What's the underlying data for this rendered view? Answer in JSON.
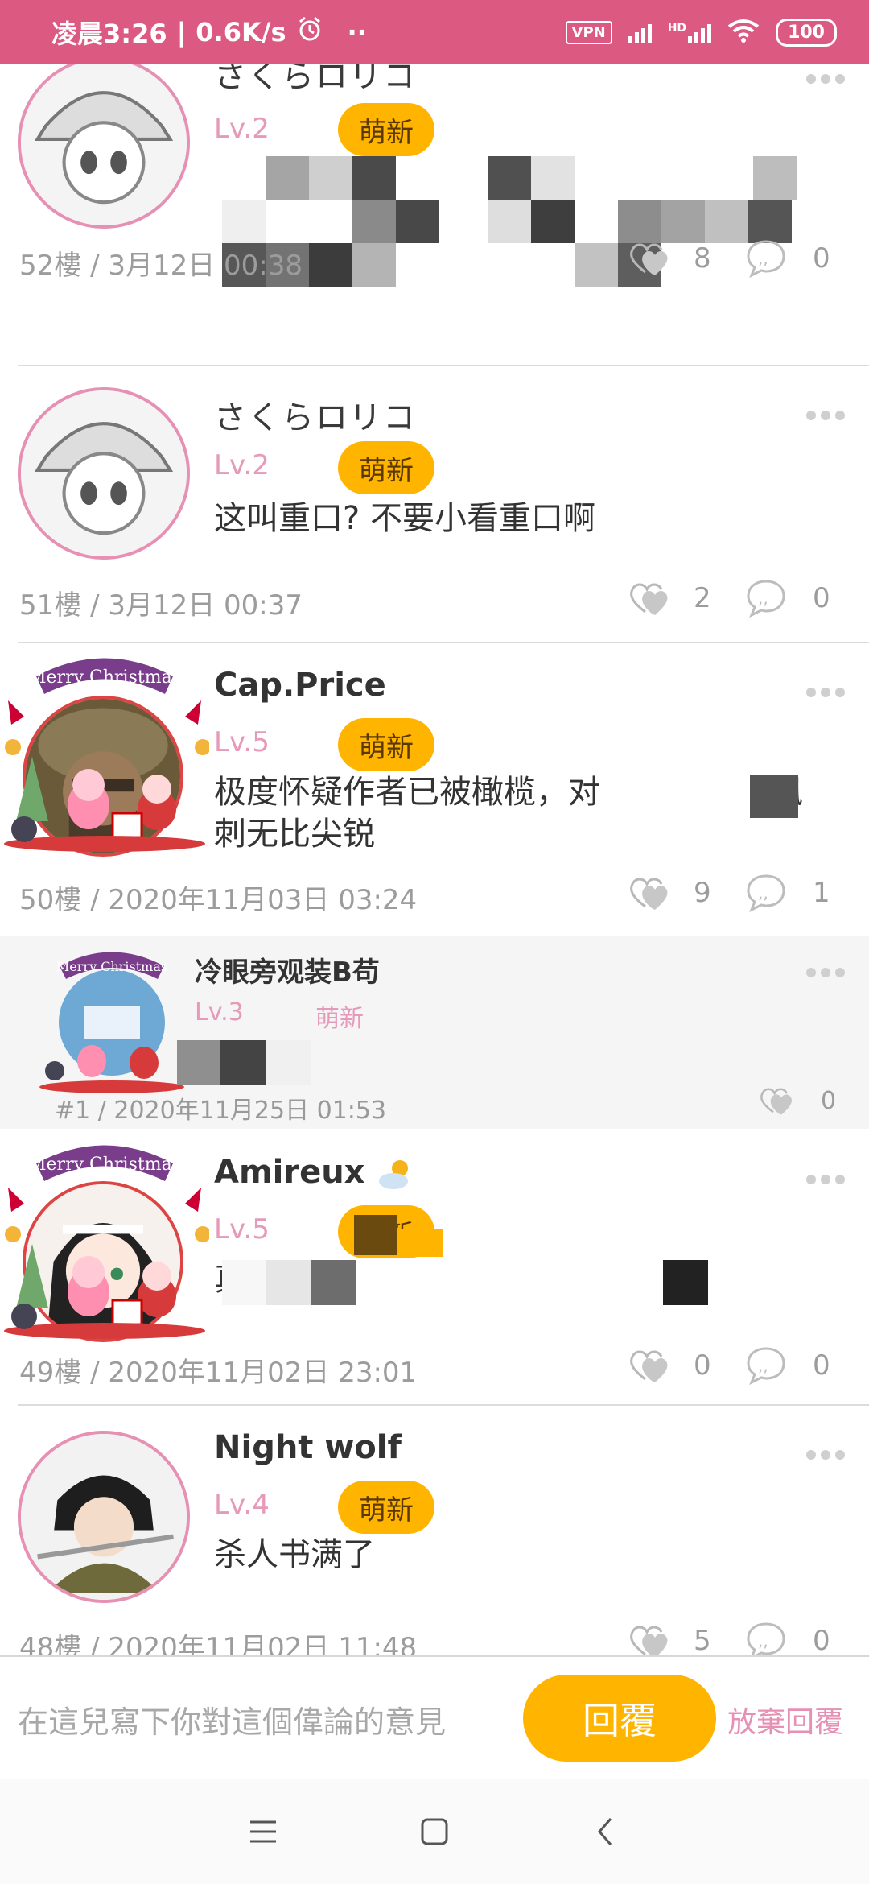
{
  "status_bar": {
    "time": "凌晨3:26",
    "speed": "0.6K/s",
    "dots": "··",
    "vpn": "VPN",
    "network_hd": "HD",
    "battery": "100"
  },
  "posts": [
    {
      "username": "さくらロリコ",
      "level": "Lv.2",
      "badge": "萌新",
      "content": "",
      "meta": "52樓 / 3月12日 00:38",
      "likes": "8",
      "comments": "0"
    },
    {
      "username": "さくらロリコ",
      "level": "Lv.2",
      "badge": "萌新",
      "content": "这叫重口? 不要小看重口啊",
      "meta": "51樓 / 3月12日 00:37",
      "likes": "2",
      "comments": "0"
    },
    {
      "username": "Cap.Price",
      "level": "Lv.5",
      "badge": "萌新",
      "content_line1": "极度怀疑作者已被橄榄，对",
      "content_line1_end": "讽",
      "content_line2": "刺无比尖锐",
      "meta": "50樓 / 2020年11月03日 03:24",
      "likes": "9",
      "comments": "1"
    },
    {
      "username": "Amireux",
      "level": "Lv.5",
      "badge": "萌新",
      "content_start": "真",
      "meta": "49樓 / 2020年11月02日 23:01",
      "likes": "0",
      "comments": "0"
    },
    {
      "username": "Night wolf",
      "level": "Lv.4",
      "badge": "萌新",
      "content": "杀人书满了",
      "meta": "48樓 / 2020年11月02日 11:48",
      "likes": "5",
      "comments": "0"
    }
  ],
  "reply": {
    "username": "冷眼旁观装B苟",
    "level": "Lv.3",
    "badge": "萌新",
    "meta": "#1 / 2020年11月25日 01:53",
    "likes": "0"
  },
  "festive_banner": "Merry Christmas",
  "input_bar": {
    "placeholder": "在這兒寫下你對這個偉論的意見",
    "reply_button": "回覆",
    "cancel_link": "放棄回覆"
  },
  "colors": {
    "accent_pink": "#dc5a82",
    "badge_orange": "#ffb400",
    "level_pink": "#e69ab9"
  }
}
